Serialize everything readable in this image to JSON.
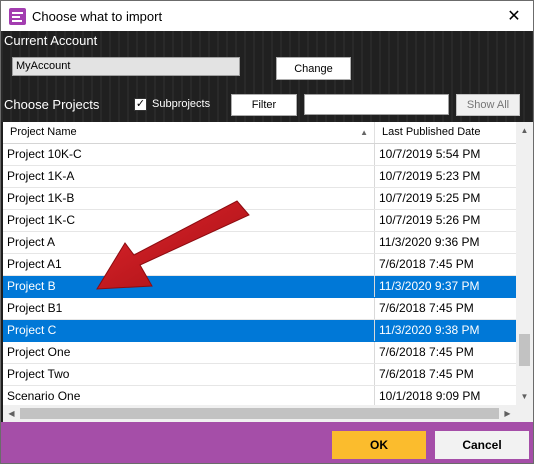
{
  "window": {
    "title": "Choose what to import",
    "close_glyph": "✕",
    "icon": "app-icon"
  },
  "account": {
    "label": "Current Account",
    "value": "MyAccount",
    "change_label": "Change"
  },
  "projects": {
    "label": "Choose Projects",
    "subprojects_label": "Subprojects",
    "subprojects_checked": true,
    "filter_label": "Filter",
    "filter_value": "",
    "show_all_label": "Show All"
  },
  "table": {
    "columns": [
      "Project Name",
      "Last Published Date"
    ],
    "sort_glyph": "▲",
    "rows": [
      {
        "name": "Project 10K-C",
        "date": "10/7/2019 5:54 PM",
        "selected": false
      },
      {
        "name": "Project 1K-A",
        "date": "10/7/2019 5:23 PM",
        "selected": false
      },
      {
        "name": "Project 1K-B",
        "date": "10/7/2019 5:25 PM",
        "selected": false
      },
      {
        "name": "Project 1K-C",
        "date": "10/7/2019 5:26 PM",
        "selected": false
      },
      {
        "name": "Project A",
        "date": "11/3/2020 9:36 PM",
        "selected": false
      },
      {
        "name": "Project A1",
        "date": "7/6/2018 7:45 PM",
        "selected": false
      },
      {
        "name": "Project B",
        "date": "11/3/2020 9:37 PM",
        "selected": true
      },
      {
        "name": "Project B1",
        "date": "7/6/2018 7:45 PM",
        "selected": false
      },
      {
        "name": "Project C",
        "date": "11/3/2020 9:38 PM",
        "selected": true
      },
      {
        "name": "Project One",
        "date": "7/6/2018 7:45 PM",
        "selected": false
      },
      {
        "name": "Project Two",
        "date": "7/6/2018 7:45 PM",
        "selected": false
      },
      {
        "name": "Scenario One",
        "date": "10/1/2018 9:09 PM",
        "selected": false
      }
    ],
    "vertical_scroll_position": 0.9
  },
  "footer": {
    "ok_label": "OK",
    "cancel_label": "Cancel"
  },
  "colors": {
    "selection": "#0078d7",
    "footer": "#a54ea8",
    "ok_button": "#fbbc2d",
    "arrow": "#c8161d"
  }
}
